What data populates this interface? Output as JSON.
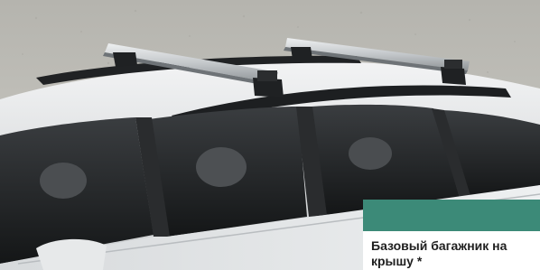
{
  "caption": {
    "title": "Базовый багажник на крышу *"
  },
  "image": {
    "subject": "silver-station-wagon-with-roof-rack"
  },
  "colors": {
    "caption_band": "#3c8a78",
    "car_body": "#dfe1e2",
    "crossbar": "#c7cbcd",
    "background": "#bdbcb6"
  }
}
